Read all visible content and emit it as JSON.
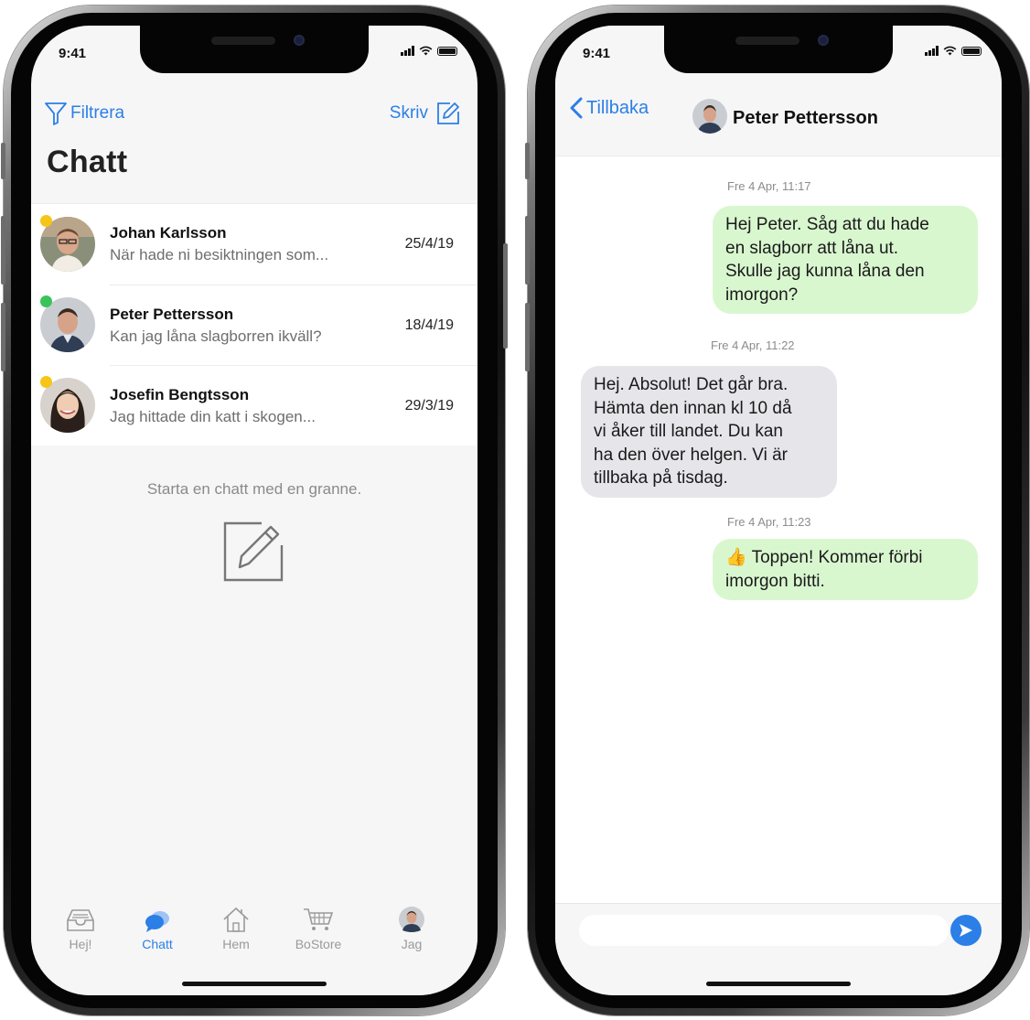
{
  "status": {
    "time": "9:41"
  },
  "left": {
    "filter_label": "Filtrera",
    "write_label": "Skriv",
    "title": "Chatt",
    "conversations": [
      {
        "name": "Johan Karlsson",
        "preview": "När hade ni besiktningen som...",
        "date": "25/4/19",
        "dot_color": "#f5c518"
      },
      {
        "name": "Peter Pettersson",
        "preview": "Kan jag låna slagborren ikväll?",
        "date": "18/4/19",
        "dot_color": "#38c45a"
      },
      {
        "name": "Josefin Bengtsson",
        "preview": "Jag hittade din katt i skogen...",
        "date": "29/3/19",
        "dot_color": "#f5c518"
      }
    ],
    "empty_text": "Starta en chatt med en granne.",
    "tabs": [
      {
        "label": "Hej!",
        "icon": "inbox-icon",
        "active": false
      },
      {
        "label": "Chatt",
        "icon": "chat-bubble-icon",
        "active": true
      },
      {
        "label": "Hem",
        "icon": "home-icon",
        "active": false
      },
      {
        "label": "BoStore",
        "icon": "cart-icon",
        "active": false
      },
      {
        "label": "Jag",
        "icon": "profile-avatar",
        "active": false
      }
    ]
  },
  "right": {
    "back_label": "Tillbaka",
    "contact_name": "Peter Pettersson",
    "messages": [
      {
        "timestamp": "Fre 4 Apr, 11:17",
        "direction": "outgoing",
        "text": [
          "Hej Peter. Såg att du hade",
          "en slagborr att låna ut.",
          "Skulle jag kunna låna den",
          "imorgon?"
        ]
      },
      {
        "timestamp": "Fre 4 Apr, 11:22",
        "direction": "incoming",
        "text": [
          "Hej. Absolut! Det går bra.",
          "Hämta den innan kl 10 då",
          "vi åker till landet. Du kan",
          "ha den över helgen. Vi är",
          "tillbaka på tisdag."
        ]
      },
      {
        "timestamp": "Fre 4 Apr, 11:23",
        "direction": "outgoing",
        "emoji": "👍",
        "text": [
          "Toppen! Kommer förbi",
          "imorgon bitti."
        ]
      }
    ],
    "input_placeholder": ""
  },
  "colors": {
    "accent": "#2b7fe6",
    "outgoing_bubble": "#d9f7cf",
    "incoming_bubble": "#e5e5ea"
  }
}
